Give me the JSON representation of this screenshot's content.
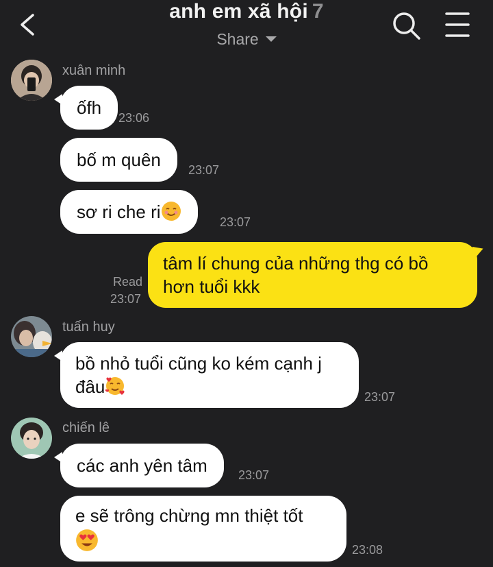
{
  "header": {
    "title": "anh em xã hội",
    "member_count": "7",
    "subtitle": "Share",
    "icons": [
      "back-icon",
      "search-icon",
      "menu-icon"
    ]
  },
  "colors": {
    "background": "#1f1f21",
    "bubble_other": "#ffffff",
    "bubble_mine": "#fbe114",
    "meta_text": "#9a9a9c"
  },
  "messages": [
    {
      "sender": "xuân minh",
      "text": "ốfh",
      "time": "23:06"
    },
    {
      "text": "bố m quên",
      "time": "23:07"
    },
    {
      "text": "sơ ri che ri",
      "emoji": "smiling-face-icon",
      "time": "23:07"
    },
    {
      "mine": true,
      "text": "tâm lí chung của những thg có bồ hơn tuổi kkk",
      "status": "Read",
      "time": "23:07"
    },
    {
      "sender": "tuấn huy",
      "text": "bồ nhỏ tuổi cũng ko kém cạnh j đâu",
      "emoji": "smiling-face-with-hearts-icon",
      "time": "23:07"
    },
    {
      "sender": "chiến lê",
      "text": "các anh yên tâm",
      "time": "23:07"
    },
    {
      "text": "e sẽ trông chừng mn thiệt tốt",
      "emoji": "heart-eyes-icon",
      "time": "23:08"
    }
  ]
}
